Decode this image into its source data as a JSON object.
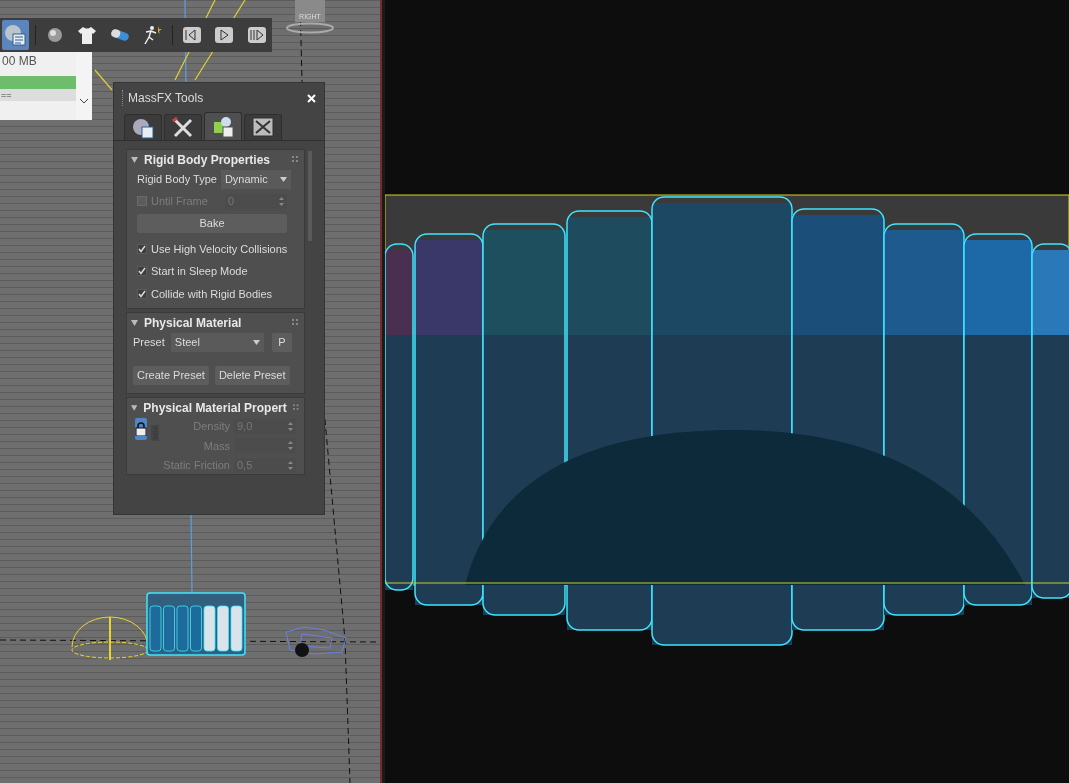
{
  "command_panel": {
    "memory": "00 MB",
    "footer": "=="
  },
  "toolbar": {
    "buttons": [
      {
        "kind": "world",
        "selected": true
      },
      {
        "kind": "sphere",
        "selected": false
      },
      {
        "kind": "cloth",
        "selected": false
      },
      {
        "kind": "capsule",
        "selected": false
      },
      {
        "kind": "ragdoll",
        "selected": false
      },
      {
        "kind": "reset",
        "selected": false
      },
      {
        "kind": "play",
        "selected": false
      },
      {
        "kind": "step",
        "selected": false
      }
    ]
  },
  "viewcube": {
    "label": "RIGHT"
  },
  "massfx": {
    "title": "MassFX Tools",
    "tabs": [
      {
        "kind": "world",
        "selected": false
      },
      {
        "kind": "tools",
        "selected": false
      },
      {
        "kind": "rigid",
        "selected": true
      },
      {
        "kind": "display",
        "selected": false
      }
    ],
    "rigid_body_properties": {
      "title": "Rigid Body Properties",
      "expanded": true,
      "type_label": "Rigid Body Type",
      "type_value": "Dynamic",
      "until_frame": {
        "label": "Until Frame",
        "value": "0",
        "checked": false,
        "disabled": true
      },
      "bake_button": "Bake",
      "options": [
        {
          "label": "Use High Velocity Collisions",
          "checked": true
        },
        {
          "label": "Start in Sleep Mode",
          "checked": true
        },
        {
          "label": "Collide with Rigid Bodies",
          "checked": true
        }
      ]
    },
    "physical_material": {
      "title": "Physical Material",
      "expanded": true,
      "preset_label": "Preset",
      "preset_value": "Steel",
      "p_button": "P",
      "create_button": "Create Preset",
      "delete_button": "Delete Preset"
    },
    "physical_material_properties": {
      "title": "Physical Material Propert",
      "expanded": true,
      "locked": true,
      "fields": [
        {
          "label": "Density",
          "value": "9,0",
          "disabled": true
        },
        {
          "label": "Mass",
          "disabled": true
        },
        {
          "label": "Static Friction",
          "value": "0,5",
          "disabled": true
        }
      ]
    }
  }
}
